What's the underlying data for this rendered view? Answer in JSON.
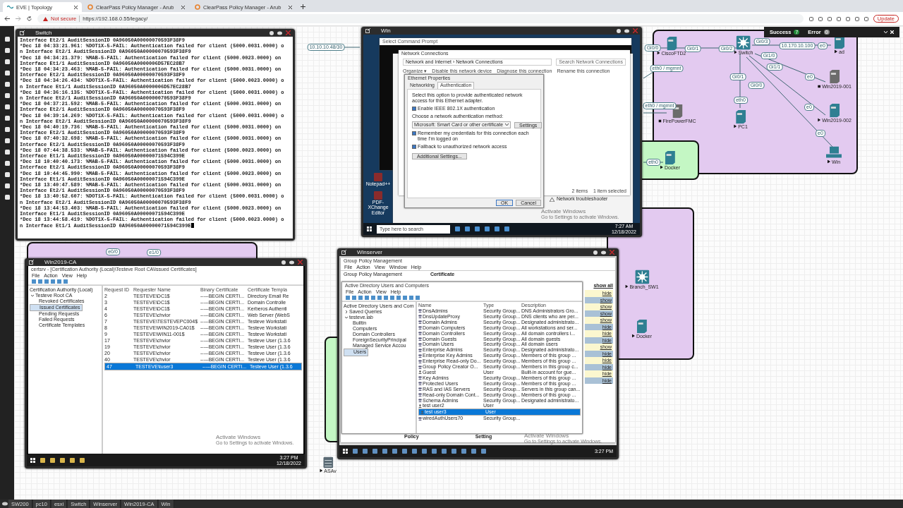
{
  "browser": {
    "tabs": [
      {
        "label": "EVE | Topology",
        "selected": true
      },
      {
        "label": "ClearPass Policy Manager - Arub",
        "selected": false
      },
      {
        "label": "ClearPass Policy Manager - Arub",
        "selected": false
      }
    ],
    "security": "Not secure",
    "url": "https://192.168.0.55/legacy/",
    "update_button": "Update"
  },
  "notification": {
    "success_label": "Success",
    "success_count": "7",
    "error_label": "Error",
    "error_count": "0"
  },
  "topology": {
    "nodes": [
      {
        "name": "CiscoFTD2",
        "kind": "server",
        "running": true
      },
      {
        "name": "Switch",
        "kind": "switch",
        "running": true
      },
      {
        "name": "ad",
        "kind": "server",
        "running": true
      },
      {
        "name": "Win2019-001",
        "kind": "server",
        "running": false
      },
      {
        "name": "Win2019-002",
        "kind": "server",
        "running": true
      },
      {
        "name": "PC1",
        "kind": "server",
        "running": true
      },
      {
        "name": "FirePowerFMC",
        "kind": "server",
        "running": false
      },
      {
        "name": "Win",
        "kind": "pc",
        "running": true
      },
      {
        "name": "Docker",
        "kind": "server",
        "running": true
      },
      {
        "name": "Branch_SW1",
        "kind": "switch",
        "running": true
      },
      {
        "name": "Docker",
        "kind": "server",
        "running": true
      },
      {
        "name": "ASAv",
        "kind": "firewall",
        "running": true
      }
    ],
    "interface_labels": [
      "Gi0/0",
      "Gi0/1",
      "Gi0/2",
      "Gi0/3",
      "10.170.10.100",
      "e0",
      "Gi1/0",
      "Gi0/1",
      "Gi1/1",
      "Gi0/0",
      "e0",
      "eth0",
      "e0",
      "e0",
      "eth0 / mgmnt",
      "eth0 / mgmnt",
      "eth0",
      "10.10.10.48/30",
      "e0/0",
      "e1/0"
    ]
  },
  "switch_console": {
    "title": "Switch",
    "lines": [
      "Interface Et2/1 AuditSessionID 0A96050A00000070593F38F9",
      "*Dec 18 04:33:21.961: %DOT1X-5-FAIL: Authentication failed for client (5000.0031.0000) o",
      "n Interface Et2/1 AuditSessionID 0A96050A00000070593F38F9",
      "*Dec 18 04:34:21.379: %MAB-5-FAIL: Authentication failed for client (5000.0023.0000) on",
      "Interface Et1/1 AuditSessionID 0A96050A0000006D57EC28B7",
      "*Dec 18 04:34:23.463: %MAB-5-FAIL: Authentication failed for client (5000.0031.0000) on",
      "Interface Et2/1 AuditSessionID 0A96050A00000070593F38F9",
      "*Dec 18 04:34:26.434: %DOT1X-5-FAIL: Authentication failed for client (5000.0023.0000) o",
      "n Interface Et1/1 AuditSessionID 0A96050A0000006D57EC28B7",
      "*Dec 18 04:36:16.135: %DOT1X-5-FAIL: Authentication failed for client (5000.0031.0000) o",
      "n Interface Et2/1 AuditSessionID 0A96050A00000070593F38F9",
      "*Dec 18 04:37:21.592: %MAB-5-FAIL: Authentication failed for client (5000.0031.0000) on",
      "Interface Et2/1 AuditSessionID 0A96050A00000070593F38F9",
      "*Dec 18 04:39:14.269: %DOT1X-5-FAIL: Authentication failed for client (5000.0031.0000) o",
      "n Interface Et2/1 AuditSessionID 0A96050A00000070593F38F9",
      "*Dec 18 04:40:19.736: %MAB-5-FAIL: Authentication failed for client (5000.0031.0000) on",
      "Interface Et2/1 AuditSessionID 0A96050A00000070593F38F9",
      "*Dec 18 07:40:32.698: %MAB-5-FAIL: Authentication failed for client (5000.0031.0000) on",
      "Interface Et2/1 AuditSessionID 0A96050A00000070593F38F9",
      "*Dec 18 07:44:38.533: %MAB-5-FAIL: Authentication failed for client (5000.0023.0000) on",
      "Interface Et1/1 AuditSessionID 0A96050A00000071594C399E",
      "*Dec 18 10:40:40.173: %MAB-5-FAIL: Authentication failed for client (5000.0031.0000) on",
      "Interface Et2/1 AuditSessionID 0A96050A00000070593F38F9",
      "*Dec 18 10:44:45.990: %MAB-5-FAIL: Authentication failed for client (5000.0023.0000) on",
      "Interface Et1/1 AuditSessionID 0A96050A00000071594C399E",
      "*Dec 18 13:40:47.589: %MAB-5-FAIL: Authentication failed for client (5000.0031.0000) on",
      "Interface Et2/1 AuditSessionID 0A96050A00000070593F38F9",
      "*Dec 18 13:40:52.607: %DOT1X-5-FAIL: Authentication failed for client (5000.0031.0000) o",
      "n Interface Et2/1 AuditSessionID 0A96050A00000070593F38F9",
      "*Dec 18 13:44:53.403: %MAB-5-FAIL: Authentication failed for client (5000.0023.0000) on",
      "Interface Et1/1 AuditSessionID 0A96050A00000071594C399E",
      "*Dec 18 13:44:58.419: %DOT1X-5-FAIL: Authentication failed for client (5000.0023.0000) o",
      "n Interface Et1/1 AuditSessionID 0A96050A00000071594C399E"
    ]
  },
  "win_console": {
    "title": "Win",
    "desktop_icons": [
      "Notepad++",
      "PDF-XChange Editor"
    ],
    "cmd_title": "Select Command Prompt",
    "netconn": {
      "title": "Network Connections",
      "path": "Network and Internet  ›  Network Connections",
      "search": "Search Network Connections",
      "toolbar": [
        "Organize ▾",
        "Disable this network device",
        "Diagnose this connection",
        "Rename this connection"
      ],
      "status": "2 items    1 item selected",
      "troubleshooter": "Network troubleshooter"
    },
    "dialog": {
      "title": "Ethernet Properties",
      "tabs": [
        {
          "label": "Networking",
          "selected": false
        },
        {
          "label": "Authentication",
          "selected": true
        }
      ],
      "intro": "Select this option to provide authenticated network access for this Ethernet adapter.",
      "enable": {
        "label": "Enable IEEE 802.1X authentication",
        "checked": true
      },
      "method_label": "Choose a network authentication method:",
      "method": "Microsoft: Smart Card or other certificate",
      "settings_button": "Settings",
      "remember": {
        "label": "Remember my credentials for this connection each time I'm logged on",
        "checked": true
      },
      "fallback": {
        "label": "Fallback to unauthorized network access",
        "checked": true
      },
      "additional_button": "Additional Settings...",
      "ok": "OK",
      "cancel": "Cancel"
    },
    "activate": "Activate Windows",
    "activate_hint": "Go to Settings to activate Windows.",
    "search_placeholder": "Type here to search",
    "time": "7:27 AM",
    "date": "12/18/2022"
  },
  "ca_console": {
    "title": "Win2019-CA",
    "window_title": "certsrv - [Certification Authority (Local)\\Testeve Root CA\\Issued Certificates]",
    "menu": [
      "File",
      "Action",
      "View",
      "Help"
    ],
    "tree": {
      "label": "Certification Authority (Local)",
      "children": [
        {
          "label": "Testeve Root CA",
          "expanded": true,
          "children": [
            {
              "label": "Revoked Certificates",
              "selected": false
            },
            {
              "label": "Issued Certificates",
              "selected": true
            },
            {
              "label": "Pending Requests",
              "selected": false
            },
            {
              "label": "Failed Requests",
              "selected": false
            },
            {
              "label": "Certificate Templates",
              "selected": false
            }
          ]
        }
      ]
    },
    "columns": [
      "Request ID",
      "Requester Name",
      "Binary Certificate",
      "Certificate Templa"
    ],
    "rows": [
      {
        "cells": [
          "2",
          "TESTEVE\\DC1$",
          "-----BEGIN CERTI...",
          "Directory Email Re"
        ],
        "selected": false
      },
      {
        "cells": [
          "3",
          "TESTEVE\\DC1$",
          "-----BEGIN CERTI...",
          "Domain Controlle"
        ],
        "selected": false
      },
      {
        "cells": [
          "4",
          "TESTEVE\\DC1$",
          "-----BEGIN CERTI...",
          "Kerberos Authenti"
        ],
        "selected": false
      },
      {
        "cells": [
          "6",
          "TESTEVE\\chvior",
          "-----BEGIN CERTI...",
          "Web Server (WebS"
        ],
        "selected": false
      },
      {
        "cells": [
          "7",
          "TESTEVE\\TESTEVEPC004$",
          "-----BEGIN CERTI...",
          "Testeve Workstati"
        ],
        "selected": false
      },
      {
        "cells": [
          "8",
          "TESTEVE\\WIN2019-CA01$",
          "-----BEGIN CERTI...",
          "Testeve Workstati"
        ],
        "selected": false
      },
      {
        "cells": [
          "9",
          "TESTEVE\\WIN11-001$",
          "-----BEGIN CERTI...",
          "Testeve Workstati"
        ],
        "selected": false
      },
      {
        "cells": [
          "17",
          "TESTEVE\\chvior",
          "-----BEGIN CERTI...",
          "Testeve User (1.3.6"
        ],
        "selected": false
      },
      {
        "cells": [
          "19",
          "TESTEVE\\chvior",
          "-----BEGIN CERTI...",
          "Testeve User (1.3.6"
        ],
        "selected": false
      },
      {
        "cells": [
          "20",
          "TESTEVE\\chvior",
          "-----BEGIN CERTI...",
          "Testeve User (1.3.6"
        ],
        "selected": false
      },
      {
        "cells": [
          "40",
          "TESTEVE\\chvior",
          "-----BEGIN CERTI...",
          "Testeve User (1.3.6"
        ],
        "selected": false
      },
      {
        "cells": [
          "47",
          "TESTEVE\\tuser3",
          "-----BEGIN CERTI...",
          "Testeve User (1.3.6"
        ],
        "selected": true
      }
    ],
    "activate": "Activate Windows",
    "activate_hint": "Go to Settings to activate Windows.",
    "time": "3:27 PM",
    "date": "12/18/2022"
  },
  "winserver_console": {
    "title": "Winserver",
    "gpm_title": "Group Policy Management",
    "gpm_menu": [
      "File",
      "Action",
      "View",
      "Window",
      "Help"
    ],
    "gpm_tree": "Group Policy Management",
    "gpm_heading": "Certificate",
    "show_all": "show all",
    "gpm_links": [
      "hide",
      "show",
      "show",
      "show",
      "show",
      "hide",
      "hide",
      "hide",
      "show",
      "hide",
      "hide",
      "hide",
      "hide",
      "hide"
    ],
    "gpm_columns": [
      "Policy",
      "Setting"
    ],
    "aduc_title": "Active Directory Users and Computers",
    "aduc_menu": [
      "File",
      "Action",
      "View",
      "Help"
    ],
    "tree": {
      "label": "Active Directory Users and Com",
      "children": [
        {
          "label": "Saved Queries",
          "expanded": false
        },
        {
          "label": "testeve.lab",
          "expanded": true,
          "children": [
            {
              "label": "Builtin",
              "selected": false
            },
            {
              "label": "Computers",
              "selected": false
            },
            {
              "label": "Domain Controllers",
              "selected": false
            },
            {
              "label": "ForeignSecurityPrincipal",
              "selected": false
            },
            {
              "label": "Managed Service Accou",
              "selected": false
            },
            {
              "label": "Users",
              "selected": true
            }
          ]
        }
      ]
    },
    "columns": [
      "Name",
      "Type",
      "Description"
    ],
    "rows": [
      {
        "kind": "group",
        "name": "DnsAdmins",
        "type": "Security Group...",
        "description": "DNS Administrators Gro...",
        "selected": false
      },
      {
        "kind": "group",
        "name": "DnsUpdateProxy",
        "type": "Security Group...",
        "description": "DNS clients who are per...",
        "selected": false
      },
      {
        "kind": "group",
        "name": "Domain Admins",
        "type": "Security Group...",
        "description": "Designated administrato...",
        "selected": false
      },
      {
        "kind": "group",
        "name": "Domain Computers",
        "type": "Security Group...",
        "description": "All workstations and ser...",
        "selected": false
      },
      {
        "kind": "group",
        "name": "Domain Controllers",
        "type": "Security Group...",
        "description": "All domain controllers i...",
        "selected": false
      },
      {
        "kind": "group",
        "name": "Domain Guests",
        "type": "Security Group...",
        "description": "All domain guests",
        "selected": false
      },
      {
        "kind": "group",
        "name": "Domain Users",
        "type": "Security Group...",
        "description": "All domain users",
        "selected": false
      },
      {
        "kind": "group",
        "name": "Enterprise Admins",
        "type": "Security Group...",
        "description": "Designated administrato...",
        "selected": false
      },
      {
        "kind": "group",
        "name": "Enterprise Key Admins",
        "type": "Security Group...",
        "description": "Members of this group ...",
        "selected": false
      },
      {
        "kind": "group",
        "name": "Enterprise Read-only Do...",
        "type": "Security Group...",
        "description": "Members of this group ...",
        "selected": false
      },
      {
        "kind": "group",
        "name": "Group Policy Creator O...",
        "type": "Security Group...",
        "description": "Members in this group c...",
        "selected": false
      },
      {
        "kind": "user",
        "name": "Guest",
        "type": "User",
        "description": "Built-in account for gue...",
        "selected": false
      },
      {
        "kind": "group",
        "name": "Key Admins",
        "type": "Security Group...",
        "description": "Members of this group ...",
        "selected": false
      },
      {
        "kind": "group",
        "name": "Protected Users",
        "type": "Security Group...",
        "description": "Members of this group ...",
        "selected": false
      },
      {
        "kind": "group",
        "name": "RAS and IAS Servers",
        "type": "Security Group...",
        "description": "Servers in this group can...",
        "selected": false
      },
      {
        "kind": "group",
        "name": "Read-only Domain Cont...",
        "type": "Security Group...",
        "description": "Members of this group ...",
        "selected": false
      },
      {
        "kind": "group",
        "name": "Schema Admins",
        "type": "Security Group...",
        "description": "Designated administrato...",
        "selected": false
      },
      {
        "kind": "user",
        "name": "test user2",
        "type": "User",
        "selected": false
      },
      {
        "kind": "user",
        "name": "test user3",
        "type": "User",
        "selected": true
      },
      {
        "kind": "group",
        "name": "wiredAuthUsers70",
        "type": "Security Group...",
        "selected": false
      }
    ],
    "activate": "Activate Windows",
    "activate_hint": "Go to Settings to activate Windows.",
    "time": "3:27 PM"
  },
  "taskbar": [
    "SW200",
    "pc10",
    "esxi",
    "Switch",
    "Winserver",
    "Win2019-CA",
    "Win"
  ]
}
